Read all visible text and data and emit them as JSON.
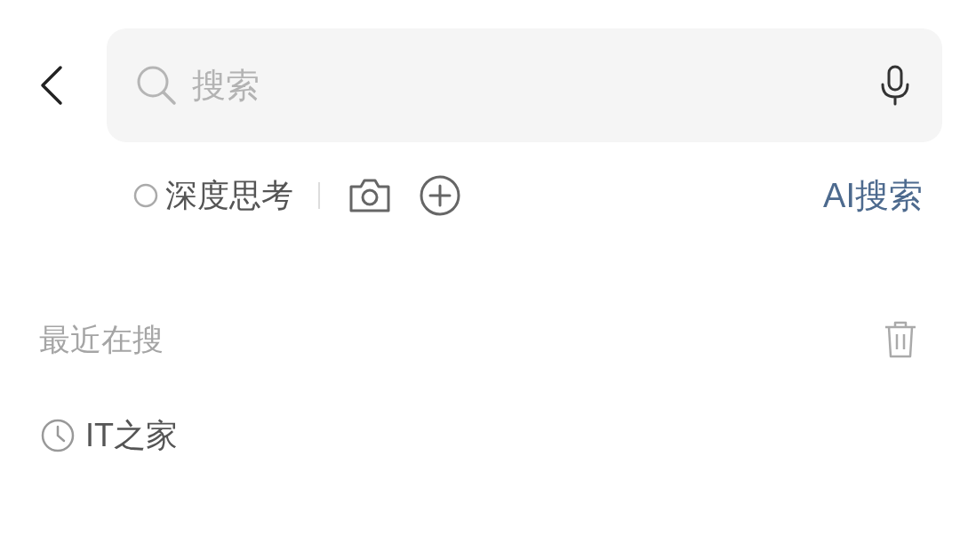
{
  "search": {
    "placeholder": "搜索"
  },
  "options": {
    "deep_think": {
      "label": "深度思考",
      "checked": false
    },
    "ai_search": "AI搜索"
  },
  "recent": {
    "title": "最近在搜",
    "items": [
      {
        "text": "IT之家"
      }
    ]
  }
}
